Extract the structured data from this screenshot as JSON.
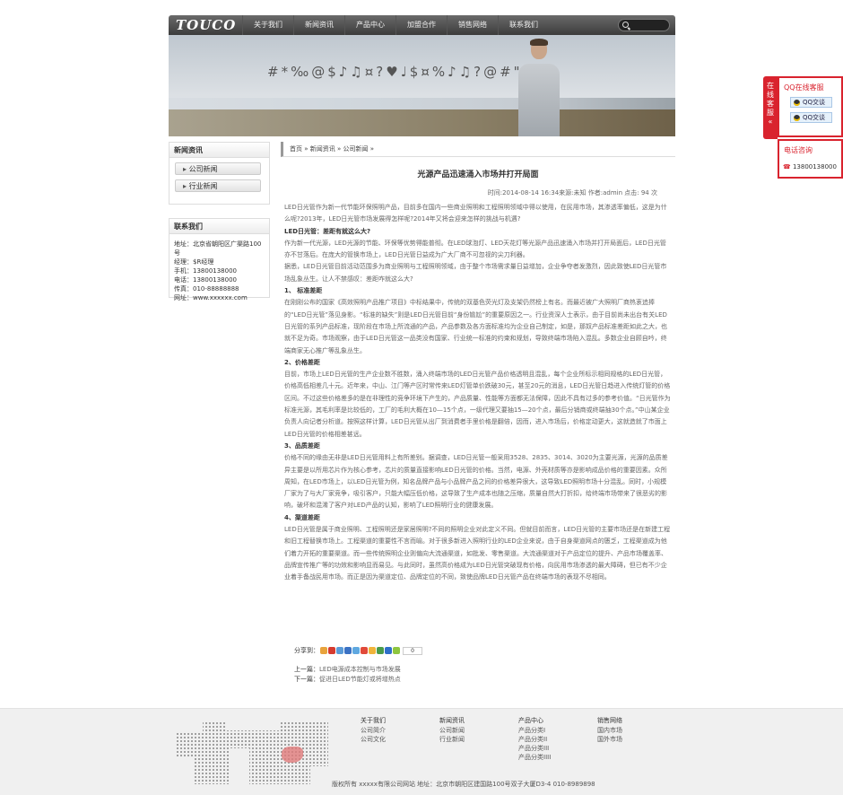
{
  "header": {
    "logo": "TOUCO",
    "nav": [
      "关于我们",
      "新闻资讯",
      "产品中心",
      "加盟合作",
      "销售网络",
      "联系我们"
    ]
  },
  "banner": {
    "glyphs": "#*‰@$♪♫¤?♥♩$¤%♪♫?@#\"@¥♩"
  },
  "sidebar": {
    "news_title": "新闻资讯",
    "news_items": [
      "公司新闻",
      "行业新闻"
    ],
    "contact_title": "联系我们",
    "contact_lines": [
      "地址：北京省朝阳区广渠路100号",
      "经理：$R经理",
      "手机：13800138000",
      "电话：13800138000",
      "传真：010-88888888",
      "网址：www.xxxxxx.com"
    ]
  },
  "breadcrumb": "首页 » 新闻资讯 » 公司新闻 »",
  "article": {
    "title": "光源产品迅速涌入市场并打开局面",
    "meta": "时间:2014-08-14 16:34来源:未知 作者:admin 点击: 94 次",
    "paragraphs": [
      {
        "h": false,
        "t": "LED日光管作为新一代节能环保照明产品，目前多在国内一些商业照明和工程照明领域中得以使用，在民用市场，其渗透率偏低，这是为什么呢?2013年，LED日光管市场发展得怎样呢?2014年又将会迎来怎样的挑战与机遇?"
      },
      {
        "h": true,
        "t": "LED日光管：差距有就这么大?"
      },
      {
        "h": false,
        "t": "作为新一代光源，LED光源的节能、环保等优势得能普彻。在LED球泡灯、LED天花灯等光源产品迅速涌入市场并打开局面后，LED日光管亦不甘落后。在庞大的管换市场上，LED日光管日益成为广大厂商不可忽视的尖刀利器。"
      },
      {
        "h": false,
        "t": "据悉，LED日光管目前活动范围多为商业照明与工程照明领域，由于整个市场需求量日益增加，企业争夺者发激烈，因此致使LED日光管市场乱象丛生。让人不禁感叹：差距咋就这么大?"
      },
      {
        "h": true,
        "t": "1、 标准差距"
      },
      {
        "h": false,
        "t": "在刚刚公布的国家《高效照明产品推广项目》中标结果中，传统的双基色荧光灯及支架仍然榜上有名。而最近被广大照明厂商热衷追捧的“LED日光管”落见身影。“标准的缺失”则是LED日光管目前“身份尴尬”的重要原因之一。行业资深人士表示，由于目前尚未出台有关LED日光管的系列产品标准，现阶段在市场上所流通的产品，产品参数及各方面标准均为企业自己制定，如是，那奴产品标准差距如此之大，也就不足为奇。市场观察，由于LED日光管这一品类没有国家、行业统一标准的约束和规划，导致终端市场陷入混乱。多数企业自顾自吟，终端商家无心推广等乱象丛生。"
      },
      {
        "h": true,
        "t": "2、价格差距"
      },
      {
        "h": false,
        "t": "目前，市场上LED日光管的生产企业数不胜数，涌入终端市场的LED日光管产品价格透明且混乱，每个企业所标示相同规格的LED日光管，价格高低相差几十元。近年来，中山、江门等产区时常传来LED灯管单价跌破30元，甚至20元的消息，LED日光管日趋进入传统灯管的价格区间。不过这些价格差多的是在非理性的竞争环境下产生的，产品质量、性能等方面都无法保障，因此不具有过多的参考价值。“日光管作为标准光源，其毛利率是比较低的，工厂的毛利大概在10—15个点，一级代理又要抽15—20个点，最后分销商或终端抽30个点。”中山某企业负责人向记者分析道。按照这样计算，LED日光管从出厂到消费者手里价格是翻倍，因而，进入市场后，价格定动更大，这就造就了市面上LED日光管的价格相差甚远。"
      },
      {
        "h": true,
        "t": "3、品质差距"
      },
      {
        "h": false,
        "t": "价格不同的缘由无非是LED日光管用料上有所差别。据调查，LED日光管一般采用3528、2835、3014、3020为主要光源，光源的品质差异主要是以所用芯片作为核心参考，芯片的质量直接影响LED日光管的价格。当然，电源、外壳材质等亦是影响成品价格的重要因素。众所周知，在LED市场上，以LED日光管为例，知名品牌产品与小品牌产品之间的价格差异很大，这导致LED照明市场十分混乱。同时，小规模厂家为了与大厂家竞争，吸引客户，只能大幅压低价格，这导致了生产成本也随之压缩，质量自然大打折扣，给终端市场带来了很恶劣的影响，破坏和混淆了客户对LED产品的认知，影响了LED照明行业的健康发展。"
      },
      {
        "h": true,
        "t": "4、渠道差距"
      },
      {
        "h": false,
        "t": "LED日光管是属于商业照明、工程照明还是家居照明?不同的照明企业对此定义不同。但就目前而言，LED日光管的主要市场还是在新建工程和旧工程替换市场上。工程渠道的重要性不言而喻。对于很多新进入照明行业的LED企业来说，由于自身渠道网点的匮乏，工程渠道成为他们着力开拓的重要渠道。而一些传统照明企业则偏向大流通渠道，如批发、零售渠道。大流通渠道对于产品定位的提升、产品市场覆盖率、品牌宣传推广等的功效和影响显而易见。与此同时，虽然高价格成为LED日光管突破现有价格，向民用市场渗透的最大障碍，但已有不少企业着手备战民用市场。而正是因为渠道定位、品牌定位的不同，致使品牌LED日光管产品在终端市场的表现不尽相同。"
      }
    ]
  },
  "share": {
    "label": "分享到：",
    "count": "0",
    "colors": [
      "#e8a33c",
      "#d63b2f",
      "#5a9bd8",
      "#3b72c4",
      "#5fa8e0",
      "#e14a3a",
      "#f0b43a",
      "#4a9b4a",
      "#2f6fc9",
      "#8ec63f"
    ]
  },
  "prevnext": {
    "prev_label": "上一篇：",
    "prev": "LED电源成本控制与市场发展",
    "next_label": "下一篇：",
    "next": "促进日LED节能灯或将增热点"
  },
  "footer": {
    "cols": [
      {
        "title": "关于我们",
        "items": [
          "公司简介",
          "公司文化"
        ]
      },
      {
        "title": "新闻资讯",
        "items": [
          "公司新闻",
          "行业新闻"
        ]
      },
      {
        "title": "产品中心",
        "items": [
          "产品分类I",
          "产品分类II",
          "产品分类III",
          "产品分类IIII"
        ]
      },
      {
        "title": "销售网络",
        "items": [
          "国内市场",
          "国外市场"
        ]
      }
    ],
    "copyright": "版权所有 xxxxx有限公司网站 地址：北京市朝阳区建国路100号双子大厦D3-4 010-8989898"
  },
  "qq": {
    "tab": "在线客服",
    "title": "QQ在线客服",
    "btns": [
      "QQ交谈",
      "QQ交谈"
    ],
    "tel_title": "电话咨询",
    "tel": "13800138000",
    "accent": "#d9232e"
  }
}
